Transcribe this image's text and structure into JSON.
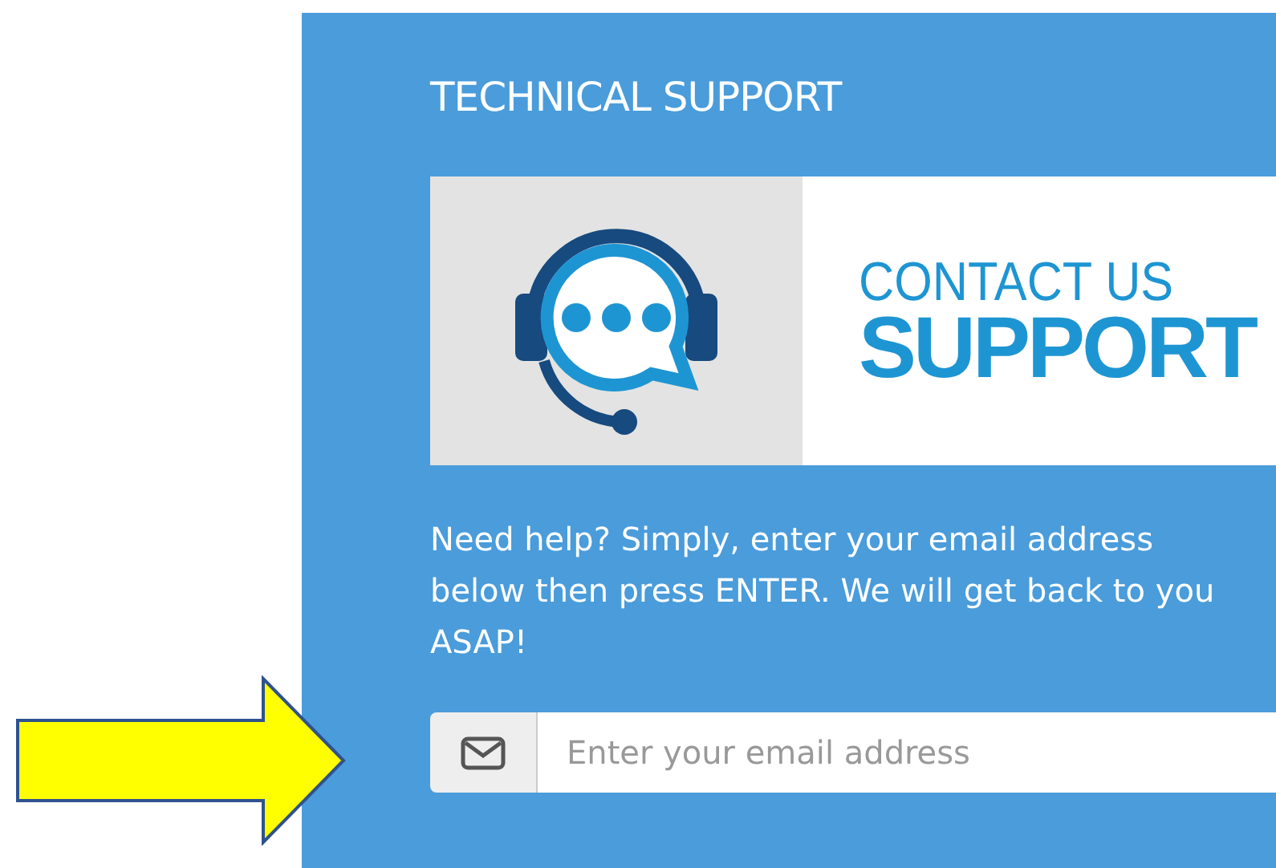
{
  "panel": {
    "title": "TECHNICAL SUPPORT",
    "banner": {
      "line_1": "CONTACT US",
      "line_2": "SUPPORT"
    },
    "message": "Need help? Simply, enter your email address below then press ENTER. We will get back to you ASAP!",
    "email_field": {
      "placeholder": "Enter your email address"
    }
  }
}
